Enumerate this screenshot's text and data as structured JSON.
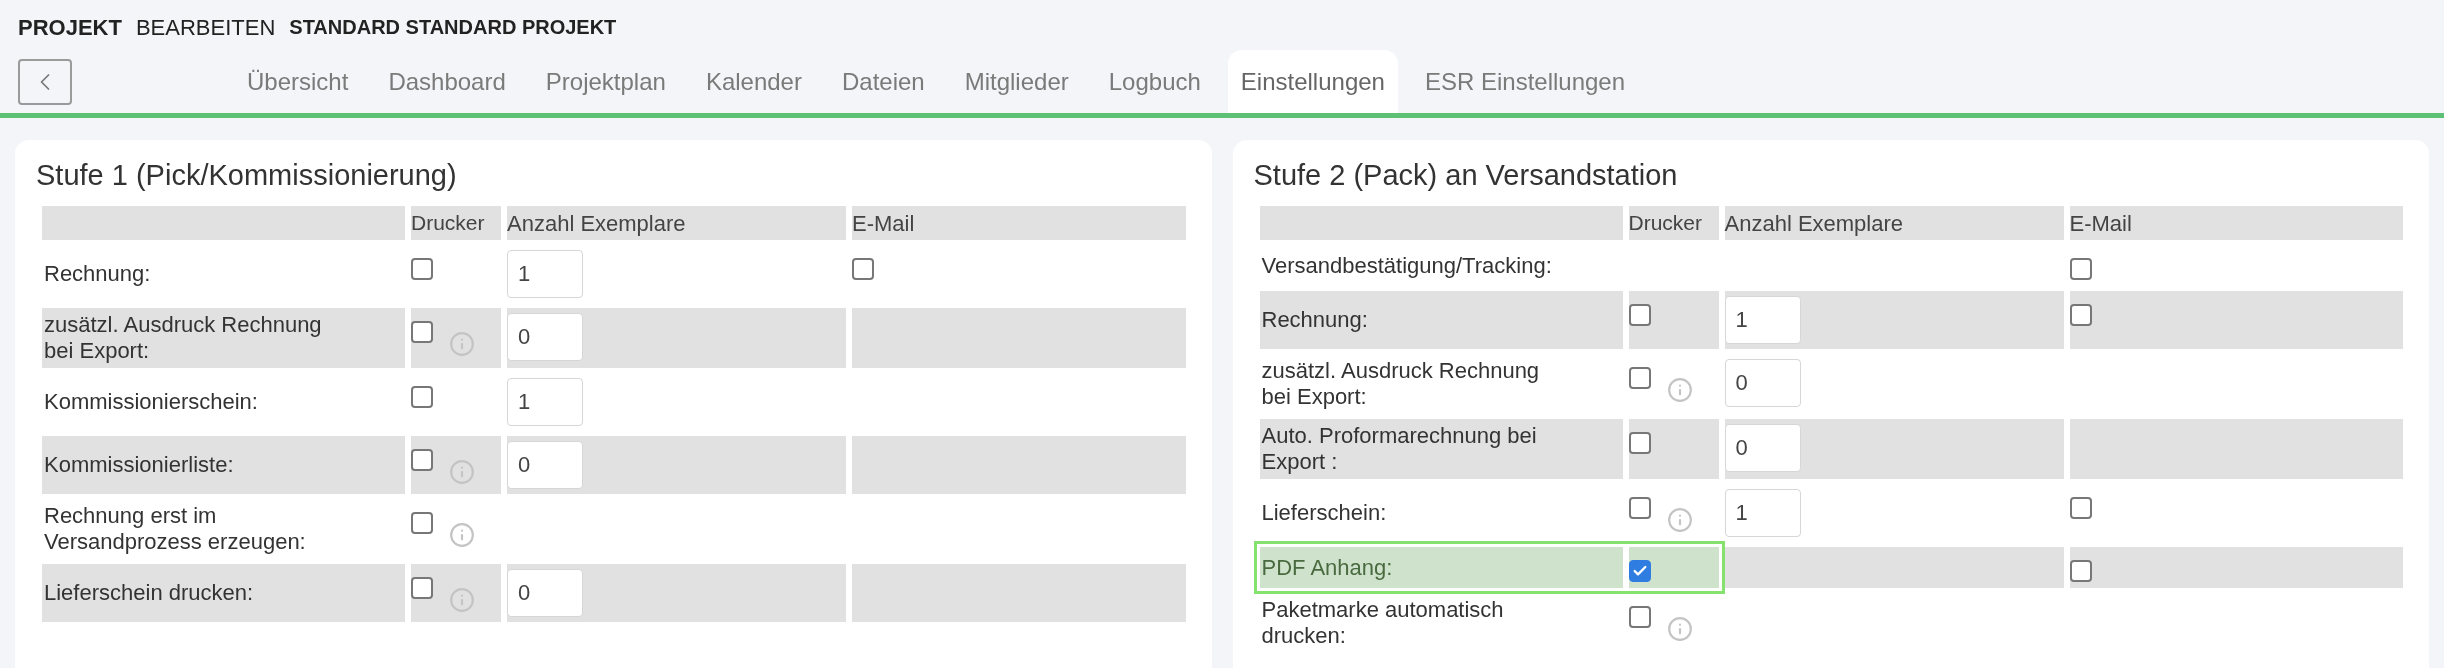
{
  "header": {
    "section": "PROJEKT",
    "action": "BEARBEITEN",
    "project": "STANDARD STANDARD PROJEKT"
  },
  "tabs": [
    {
      "label": "Übersicht",
      "selected": false
    },
    {
      "label": "Dashboard",
      "selected": false
    },
    {
      "label": "Projektplan",
      "selected": false
    },
    {
      "label": "Kalender",
      "selected": false
    },
    {
      "label": "Dateien",
      "selected": false
    },
    {
      "label": "Mitglieder",
      "selected": false
    },
    {
      "label": "Logbuch",
      "selected": false
    },
    {
      "label": "Einstellungen",
      "selected": true
    },
    {
      "label": "ESR Einstellungen",
      "selected": false
    }
  ],
  "panels": [
    {
      "title": "Stufe 1 (Pick/Kommissionierung)",
      "columns": [
        "Drucker",
        "Anzahl Exemplare",
        "E-Mail"
      ],
      "rows": [
        {
          "label": "Rechnung:",
          "printer": {
            "checked": false
          },
          "info": false,
          "copies": "1",
          "email": {
            "checked": false
          },
          "highlighted": false
        },
        {
          "label": "zusätzl. Ausdruck Rechnung bei Export:",
          "printer": {
            "checked": false
          },
          "info": true,
          "copies": "0",
          "highlighted": false
        },
        {
          "label": "Kommissionierschein:",
          "printer": {
            "checked": false
          },
          "info": false,
          "copies": "1",
          "highlighted": false
        },
        {
          "label": "Kommissionierliste:",
          "printer": {
            "checked": false
          },
          "info": true,
          "copies": "0",
          "highlighted": false
        },
        {
          "label": "Rechnung erst im Versandprozess erzeugen:",
          "printer": {
            "checked": false
          },
          "info": true,
          "highlighted": false
        },
        {
          "label": "Lieferschein drucken:",
          "printer": {
            "checked": false
          },
          "info": true,
          "copies": "0",
          "highlighted": false
        }
      ]
    },
    {
      "title": "Stufe 2 (Pack) an Versandstation",
      "columns": [
        "Drucker",
        "Anzahl Exemplare",
        "E-Mail"
      ],
      "rows": [
        {
          "label": "Versandbestätigung/Tracking:",
          "info": false,
          "email": {
            "checked": false
          },
          "highlighted": false
        },
        {
          "label": "Rechnung:",
          "printer": {
            "checked": false
          },
          "info": false,
          "copies": "1",
          "email": {
            "checked": false
          },
          "highlighted": false
        },
        {
          "label": "zusätzl. Ausdruck Rechnung bei Export:",
          "printer": {
            "checked": false
          },
          "info": true,
          "copies": "0",
          "highlighted": false
        },
        {
          "label": "Auto. Proformarechnung bei Export :",
          "printer": {
            "checked": false
          },
          "info": false,
          "copies": "0",
          "highlighted": false
        },
        {
          "label": "Lieferschein:",
          "printer": {
            "checked": false
          },
          "info": true,
          "copies": "1",
          "email": {
            "checked": false
          },
          "highlighted": false
        },
        {
          "label": "PDF Anhang:",
          "printer": {
            "checked": true
          },
          "info": false,
          "email": {
            "checked": false
          },
          "highlighted": true
        },
        {
          "label": "Paketmarke automatisch drucken:",
          "printer": {
            "checked": false
          },
          "info": true,
          "highlighted": false
        }
      ]
    }
  ]
}
